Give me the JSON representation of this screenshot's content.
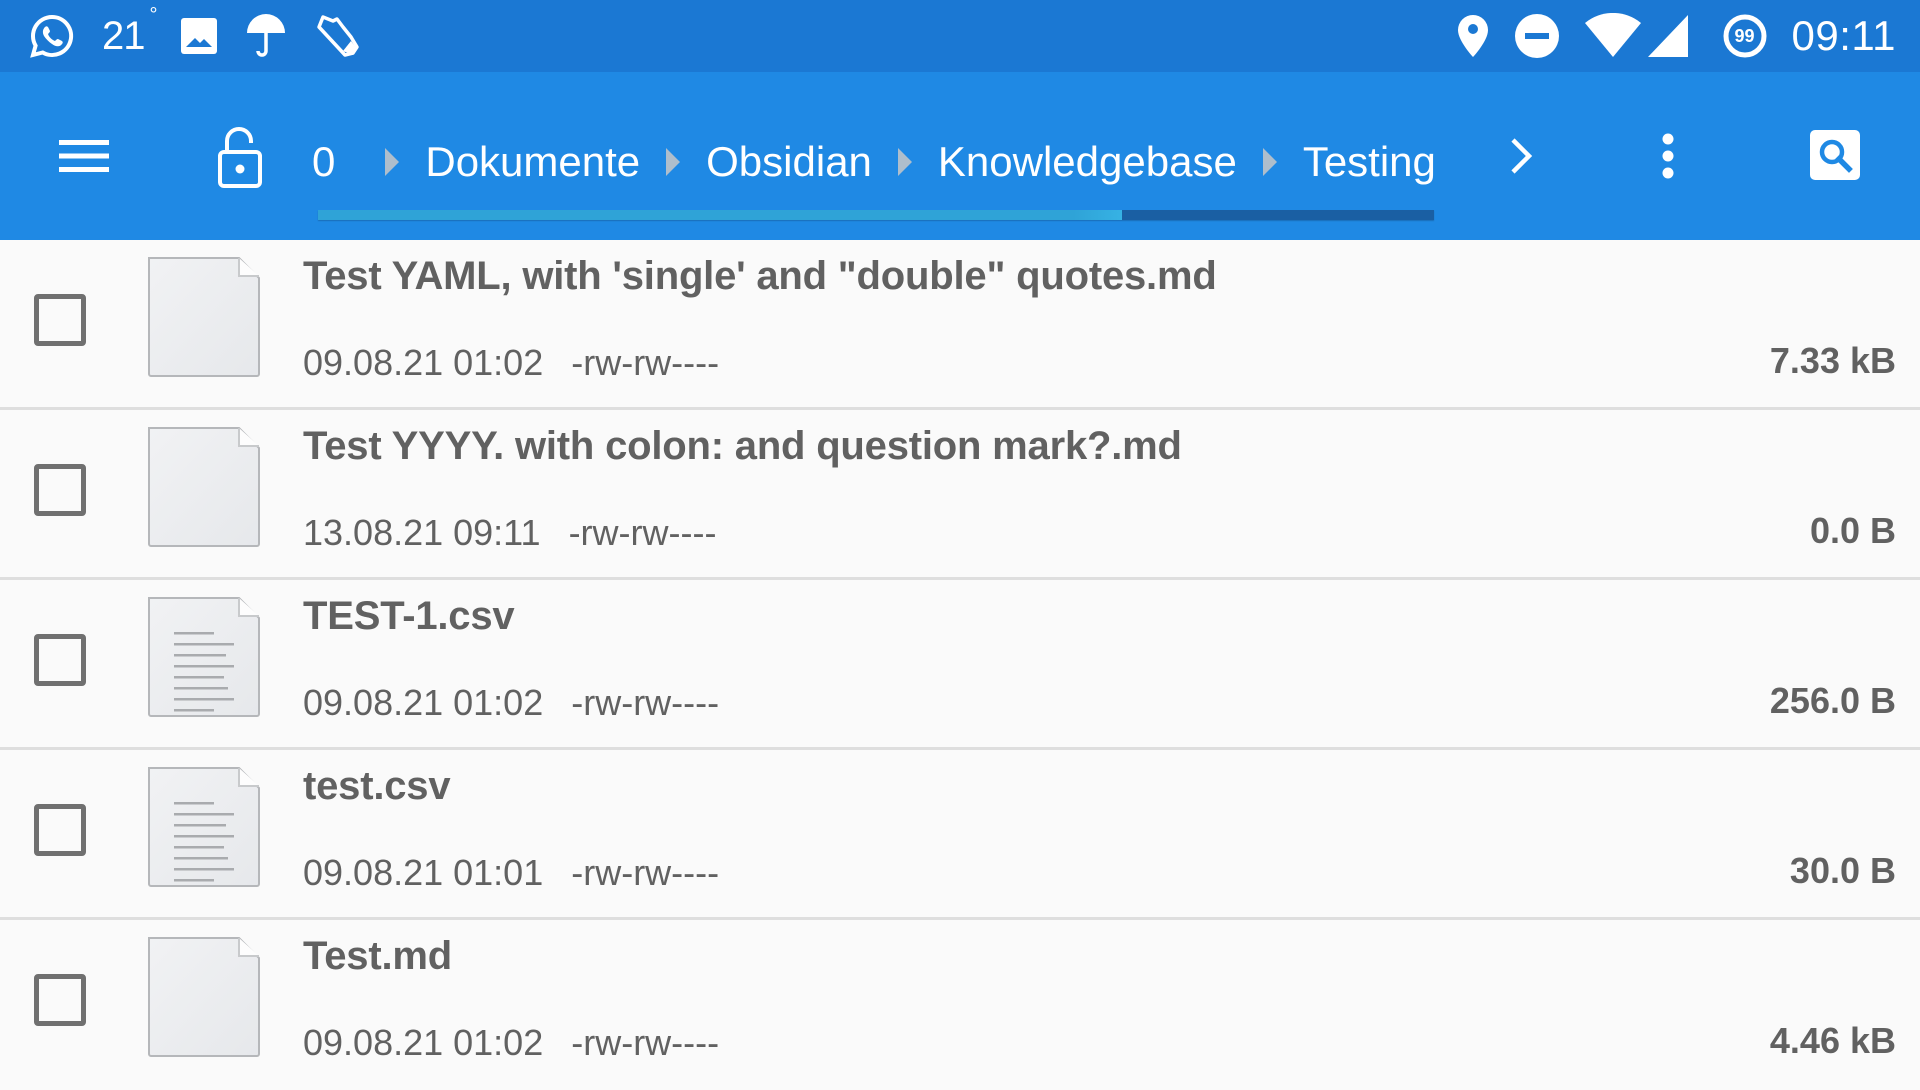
{
  "status_bar": {
    "left_icons": [
      "whatsapp-icon",
      "weather-temp",
      "gallery-icon",
      "umbrella-icon",
      "sneaker-icon"
    ],
    "temperature": "21",
    "temperature_unit": "°",
    "right_icons": [
      "location-pin-icon",
      "do-not-disturb-icon",
      "wifi-icon",
      "cell-signal-icon",
      "notification-count-icon"
    ],
    "notification_badge": "99",
    "time": "09:11"
  },
  "toolbar": {
    "menu_icon": "hamburger-menu-icon",
    "lock_icon": "unlocked-padlock-icon",
    "breadcrumbs": [
      {
        "label": "0"
      },
      {
        "label": "Dokumente"
      },
      {
        "label": "Obsidian"
      },
      {
        "label": "Knowledgebase"
      },
      {
        "label": "Testing"
      }
    ],
    "next_icon": "chevron-right-icon",
    "more_icon": "more-vertical-icon",
    "search_icon": "search-icon",
    "scroll_progress_percent": 72,
    "colors": {
      "status_bar": "#1b78d3",
      "toolbar": "#1f89e4",
      "progress_track": "#1a5fa3",
      "progress_fill": "#2fa3d7"
    }
  },
  "files": [
    {
      "name": "Test YAML, with 'single' and \"double\" quotes.md",
      "date": "09.08.21 01:02",
      "permissions": "-rw-rw----",
      "size": "7.33 kB",
      "icon": "blank-document-icon",
      "checked": false
    },
    {
      "name": "Test YYYY. with colon: and question mark?.md",
      "date": "13.08.21 09:11",
      "permissions": "-rw-rw----",
      "size": "0.0 B",
      "icon": "blank-document-icon",
      "checked": false
    },
    {
      "name": "TEST-1.csv",
      "date": "09.08.21 01:02",
      "permissions": "-rw-rw----",
      "size": "256.0 B",
      "icon": "text-document-icon",
      "checked": false
    },
    {
      "name": "test.csv",
      "date": "09.08.21 01:01",
      "permissions": "-rw-rw----",
      "size": "30.0 B",
      "icon": "text-document-icon",
      "checked": false
    },
    {
      "name": "Test.md",
      "date": "09.08.21 01:02",
      "permissions": "-rw-rw----",
      "size": "4.46 kB",
      "icon": "blank-document-icon",
      "checked": false
    }
  ]
}
